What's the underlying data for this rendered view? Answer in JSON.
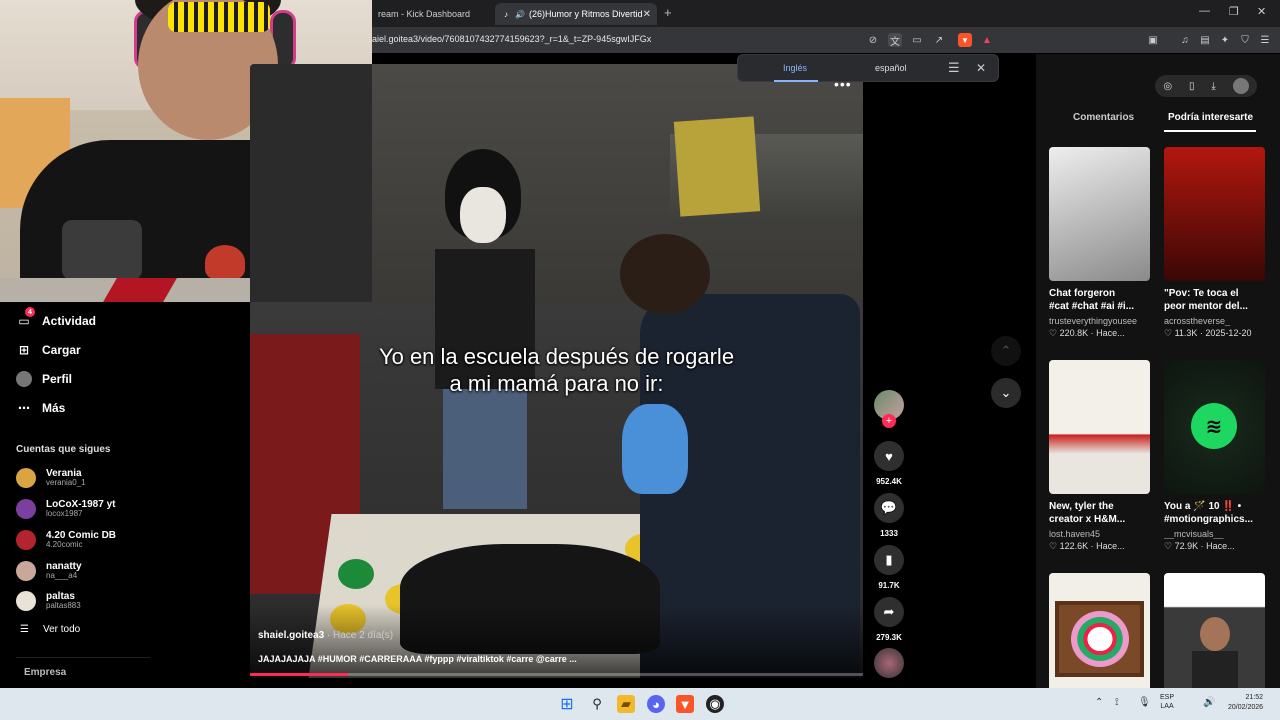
{
  "browser": {
    "tabs": [
      {
        "label": "ream - Kick Dashboard"
      },
      {
        "label": "(26)Humor y Ritmos Divertid"
      }
    ],
    "url": "aiel.goitea3/video/7608107432774159623?_r=1&_t=ZP-945sgwIJFGx"
  },
  "translate": {
    "lang_from": "Inglés",
    "lang_to": "español"
  },
  "sidebar": {
    "items": [
      {
        "label": "Actividad",
        "badge": "4"
      },
      {
        "label": "Cargar"
      },
      {
        "label": "Perfil"
      },
      {
        "label": "Más"
      }
    ],
    "following_title": "Cuentas que sigues",
    "following": [
      {
        "name": "Verania",
        "user": "verania0_1",
        "color": "#d9a441"
      },
      {
        "name": "LoCoX-1987 yt",
        "user": "locox1987",
        "color": "#7b3fa0"
      },
      {
        "name": "4.20 Comic DB",
        "user": "4.20comic",
        "color": "#b3242e"
      },
      {
        "name": "nanatty",
        "user": "na___a4",
        "color": "#c9a79a"
      },
      {
        "name": "paltas",
        "user": "paltas883",
        "color": "#e9e2d8"
      }
    ],
    "see_all": "Ver todo",
    "company": "Empresa"
  },
  "video": {
    "caption_line1": "Yo en la escuela después de rogarle",
    "caption_line2": "a mi mamá para no ir:",
    "author": "shaiel.goitea3",
    "time": " · Hace 2 día(s)",
    "description": "JAJAJAJAJA #HUMOR #CARRERAAA #fyppp #viraltiktok #carre @carre ...",
    "progress": 0.16
  },
  "actions": {
    "likes": "952.4K",
    "comments": "1333",
    "saves": "91.7K",
    "shares": "279.3K"
  },
  "right_panel": {
    "tabs": [
      "Comentarios",
      "Podría interesarte"
    ],
    "cards": [
      {
        "title": "Chat forgeron\n#cat #chat #ai #i...",
        "user": "trusteverythingyousee",
        "meta": "♡ 220.8K · Hace...",
        "color1": "#eeeeee",
        "color2": "#8a8a8a"
      },
      {
        "title": "\"Pov: Te toca el\npeor mentor del...",
        "user": "acrosstheverse_",
        "meta": "♡ 11.3K · 2025-12-20",
        "color1": "#b3170f",
        "color2": "#3a0705"
      },
      {
        "title": "New, tyler the\ncreator x H&M...",
        "user": "lost.haven45",
        "meta": "♡ 122.6K · Hace...",
        "color1": "#f3f0ea",
        "color2": "#c8231f"
      },
      {
        "title": "You a 🪄 10 ‼️ •\n#motiongraphics...",
        "user": "__mcvisuals__",
        "meta": "♡ 72.9K · Hace...",
        "color1": "#1a2a1d",
        "color2": "#0d150f"
      },
      {
        "title": "",
        "user": "",
        "meta": "",
        "color1": "#f2efe9",
        "color2": "#7a4a28"
      },
      {
        "title": "",
        "user": "",
        "meta": "",
        "color1": "#ffffff",
        "color2": "#3a3a3a"
      }
    ]
  },
  "taskbar": {
    "lang": "ESP",
    "lang2": "LAA",
    "time": "21:52",
    "date": "20/02/2026"
  }
}
